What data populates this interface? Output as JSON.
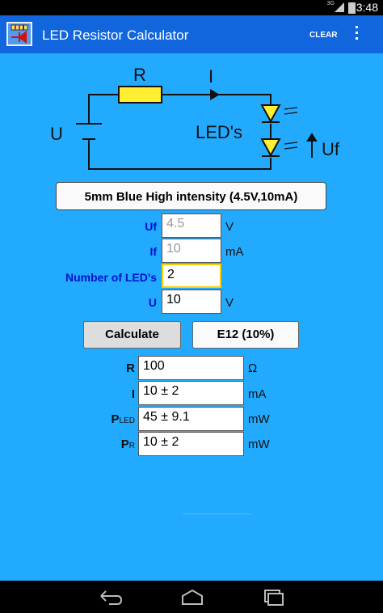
{
  "status_bar": {
    "network": "3G",
    "time": "3:48"
  },
  "action_bar": {
    "title": "LED Resistor Calculator",
    "clear_label": "CLEAR"
  },
  "circuit": {
    "resistor_label": "R",
    "current_label": "I",
    "led_label": "LED's",
    "voltage_label": "U",
    "forward_voltage_label": "Uf"
  },
  "preset": {
    "label": "5mm Blue High intensity (4.5V,10mA)"
  },
  "inputs": {
    "uf": {
      "label": "Uf",
      "placeholder": "4.5",
      "unit": "V"
    },
    "if": {
      "label": "If",
      "placeholder": "10",
      "unit": "mA"
    },
    "number_of_leds": {
      "label": "Number of LED's",
      "value": "2"
    },
    "u": {
      "label": "U",
      "value": "10",
      "unit": "V"
    }
  },
  "buttons": {
    "calculate": "Calculate",
    "series": "E12 (10%)"
  },
  "results": {
    "r": {
      "label": "R",
      "value": "100",
      "unit": "Ω"
    },
    "i": {
      "label": "I",
      "value": "10 ± 2",
      "unit": "mA"
    },
    "p_led": {
      "label": "P",
      "sub": "LED",
      "value": "45 ± 9.1",
      "unit": "mW"
    },
    "p_r": {
      "label": "P",
      "sub": "R",
      "value": "10 ± 2",
      "unit": "mW"
    }
  }
}
